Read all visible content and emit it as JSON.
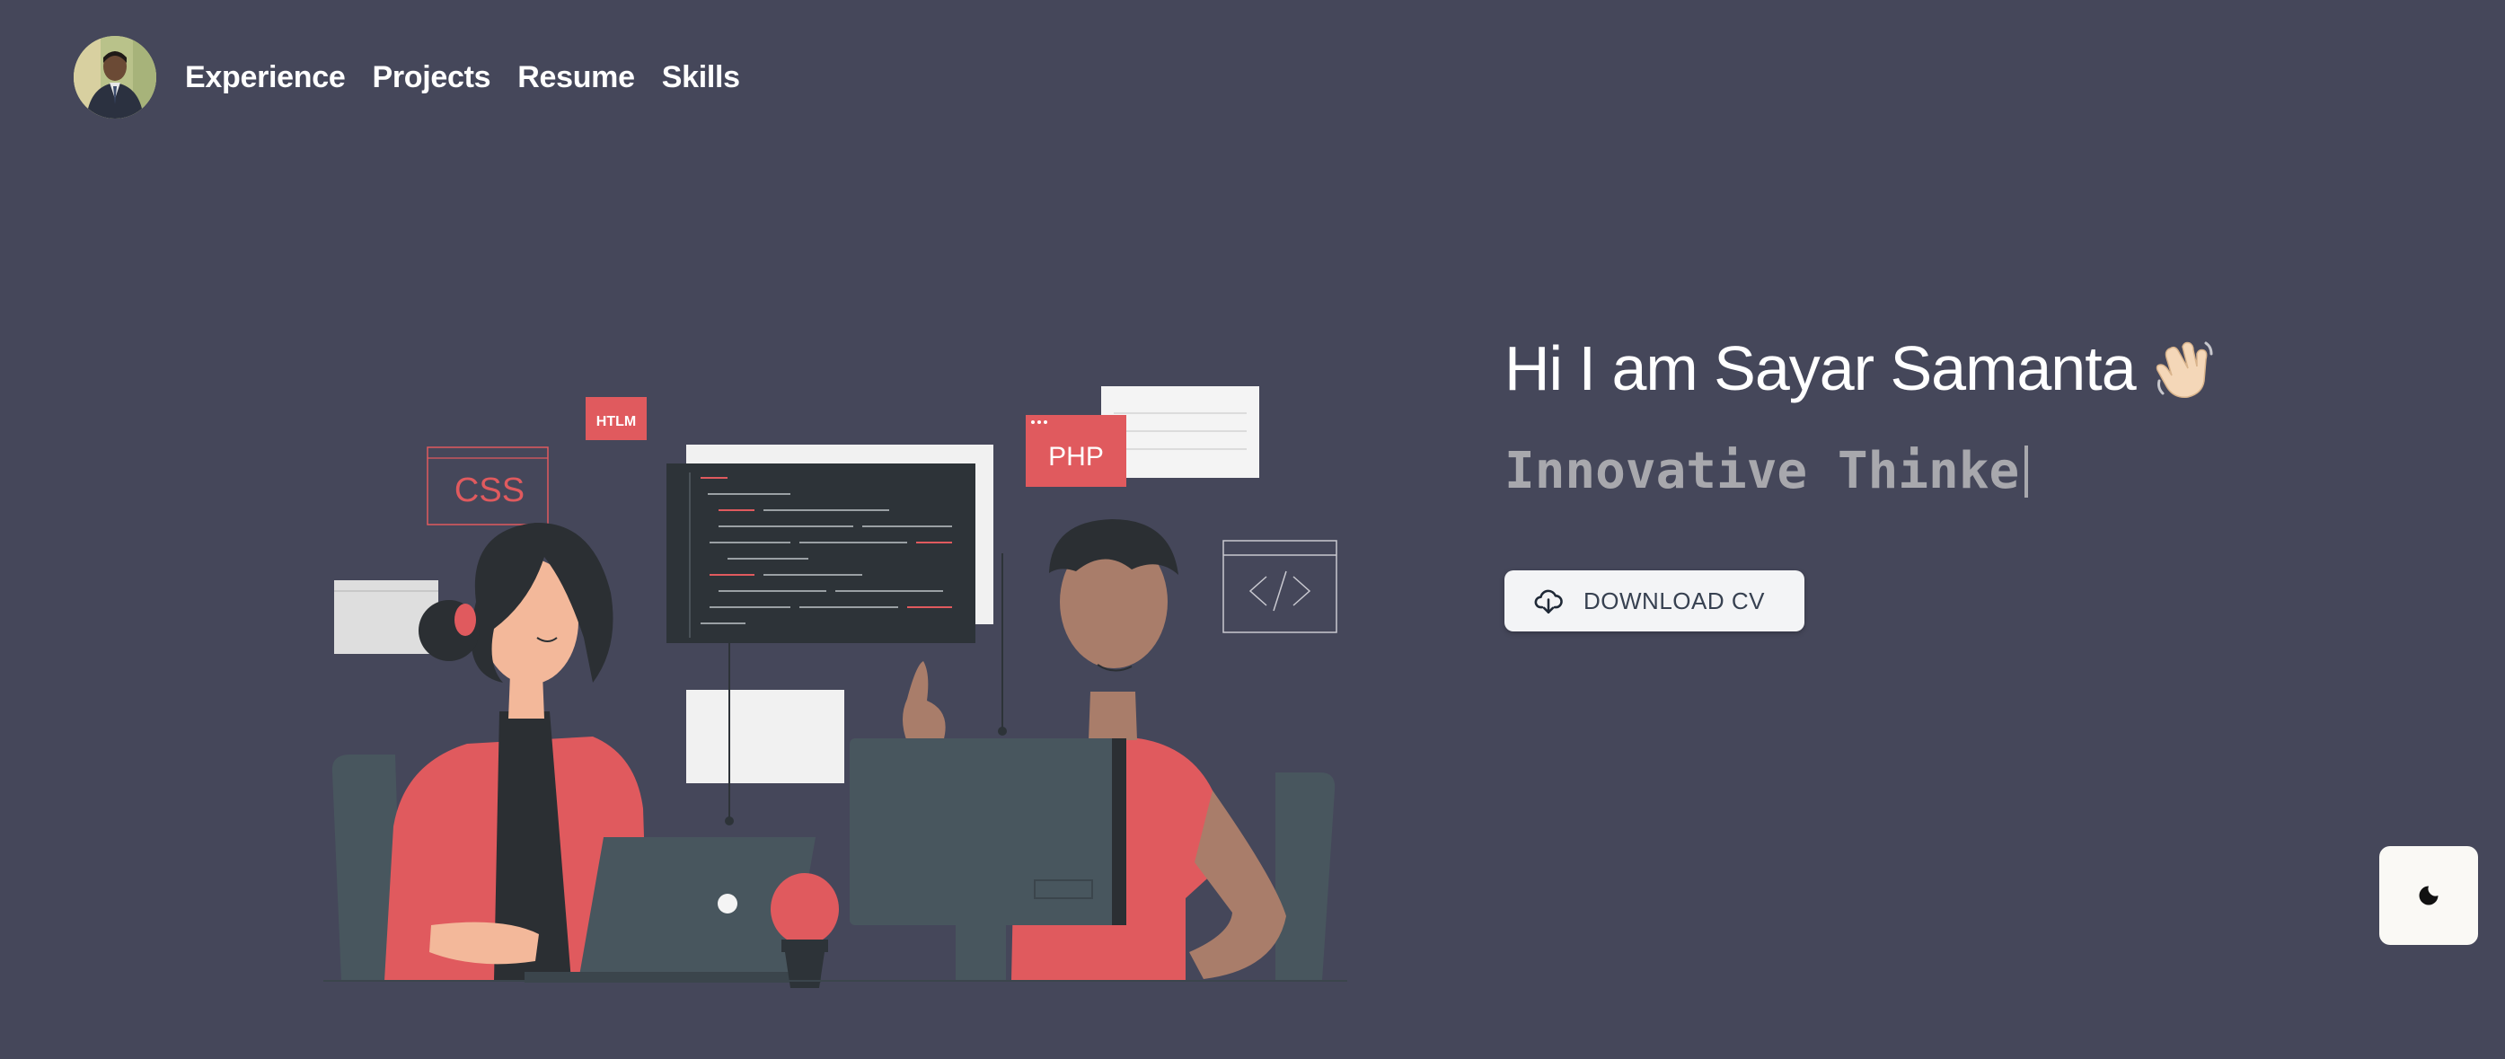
{
  "nav": {
    "links": [
      "Experience",
      "Projects",
      "Resume",
      "Skills"
    ]
  },
  "hero": {
    "greeting": "Hi I am Sayar Samanta",
    "typed_text": "Innovative Thinke",
    "download_label": "DOWNLOAD CV"
  },
  "illustration": {
    "tag_html": "HTLM",
    "tag_css": "CSS",
    "tag_php": "PHP"
  },
  "icons": {
    "avatar": "profile-photo",
    "wave": "waving-hand-icon",
    "download": "cloud-download-icon",
    "theme": "moon-icon"
  },
  "colors": {
    "background": "#45475a",
    "accent": "#e05a5e",
    "button_bg": "#f3f4f6",
    "muted_text": "#a8a8ad"
  }
}
